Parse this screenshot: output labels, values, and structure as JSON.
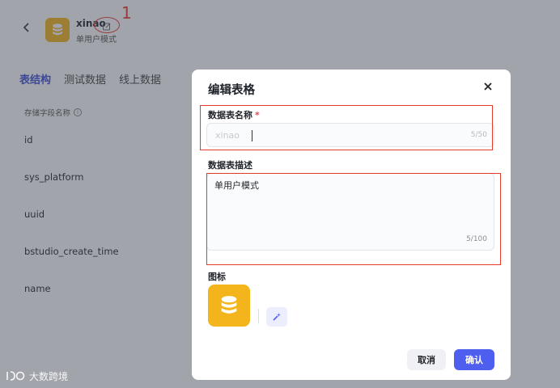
{
  "header": {
    "back_icon": "chevron-left-icon",
    "app_name": "xinao",
    "app_mode": "单用户模式",
    "edit_icon": "edit-icon",
    "annotation_number": "1"
  },
  "tabs": [
    {
      "label": "表结构",
      "active": true
    },
    {
      "label": "测试数据",
      "active": false
    },
    {
      "label": "线上数据",
      "active": false
    }
  ],
  "fields": {
    "header": "存储字段名称",
    "rows": [
      "id",
      "sys_platform",
      "uuid",
      "bstudio_create_time",
      "name"
    ]
  },
  "modal": {
    "title": "编辑表格",
    "name_label": "数据表名称",
    "required_mark": "*",
    "name_value": "xinao",
    "name_counter": "5/50",
    "desc_label": "数据表描述",
    "desc_value": "单用户模式",
    "desc_counter": "5/100",
    "icon_label": "图标",
    "cancel_label": "取消",
    "confirm_label": "确认"
  },
  "watermark": "大数跨境",
  "colors": {
    "accent": "#4e5ff0",
    "icon_bg": "#f3b51b",
    "annotation": "#e53a2a"
  }
}
